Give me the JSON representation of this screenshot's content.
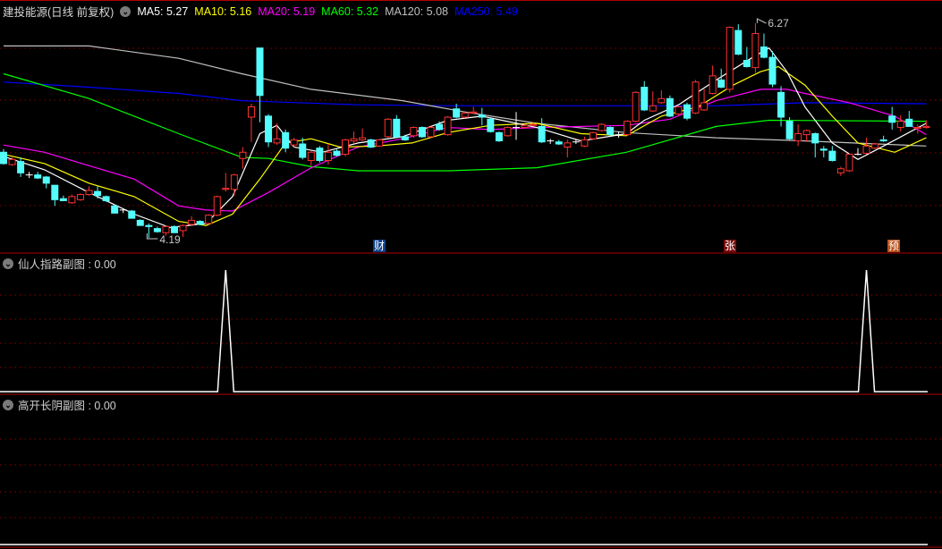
{
  "header": {
    "title": "建投能源(日线 前复权)",
    "ma": [
      {
        "label": "MA5: 5.27",
        "color": "#ffffff"
      },
      {
        "label": "MA10: 5.16",
        "color": "#ffff00"
      },
      {
        "label": "MA20: 5.19",
        "color": "#ff00ff"
      },
      {
        "label": "MA60: 5.32",
        "color": "#00ff00"
      },
      {
        "label": "MA120: 5.08",
        "color": "#c0c0c0"
      },
      {
        "label": "MA250: 5.49",
        "color": "#0000ff"
      }
    ]
  },
  "markers": [
    {
      "text": "财",
      "bg": "#0b3f8a"
    },
    {
      "text": "张",
      "bg": "#7a0c0c"
    },
    {
      "text": "预",
      "bg": "#b8501a"
    }
  ],
  "sub1": {
    "label": "仙人指路副图 : 0.00"
  },
  "sub2": {
    "label": "高开长阴副图 : 0.00"
  },
  "chart_data": {
    "type": "candlestick",
    "title": "建投能源(日线 前复权)",
    "ylim": [
      4.19,
      6.27
    ],
    "high_label": "6.27",
    "low_label": "4.19",
    "colors": {
      "up": "#ff3232",
      "down": "#54fcfc",
      "flat": "#ffffff",
      "grid": "#8b0000"
    },
    "ohlc": [
      [
        5.02,
        5.05,
        4.9,
        4.91
      ],
      [
        4.9,
        4.97,
        4.89,
        4.95
      ],
      [
        4.93,
        4.97,
        4.78,
        4.82
      ],
      [
        4.8,
        4.83,
        4.77,
        4.8
      ],
      [
        4.8,
        4.83,
        4.76,
        4.77
      ],
      [
        4.78,
        4.79,
        4.67,
        4.72
      ],
      [
        4.7,
        4.7,
        4.5,
        4.56
      ],
      [
        4.57,
        4.6,
        4.55,
        4.55
      ],
      [
        4.53,
        4.61,
        4.52,
        4.59
      ],
      [
        4.56,
        4.62,
        4.55,
        4.61
      ],
      [
        4.61,
        4.69,
        4.6,
        4.65
      ],
      [
        4.64,
        4.69,
        4.57,
        4.6
      ],
      [
        4.59,
        4.6,
        4.54,
        4.55
      ],
      [
        4.5,
        4.51,
        4.43,
        4.43
      ],
      [
        4.46,
        4.47,
        4.43,
        4.46
      ],
      [
        4.45,
        4.46,
        4.38,
        4.38
      ],
      [
        4.36,
        4.37,
        4.31,
        4.31
      ],
      [
        4.31,
        4.33,
        4.19,
        4.3
      ],
      [
        4.28,
        4.3,
        4.24,
        4.25
      ],
      [
        4.24,
        4.31,
        4.21,
        4.3
      ],
      [
        4.3,
        4.31,
        4.24,
        4.24
      ],
      [
        4.26,
        4.32,
        4.2,
        4.31
      ],
      [
        4.32,
        4.4,
        4.31,
        4.36
      ],
      [
        4.35,
        4.36,
        4.32,
        4.32
      ],
      [
        4.33,
        4.42,
        4.32,
        4.41
      ],
      [
        4.41,
        4.6,
        4.4,
        4.59
      ],
      [
        4.66,
        4.82,
        4.64,
        4.67
      ],
      [
        4.66,
        4.81,
        4.6,
        4.8
      ],
      [
        4.96,
        5.07,
        4.86,
        5.02
      ],
      [
        5.36,
        5.49,
        5.12,
        5.46
      ],
      [
        6.03,
        6.03,
        5.31,
        5.57
      ],
      [
        5.37,
        5.39,
        5.07,
        5.12
      ],
      [
        5.11,
        5.3,
        5.09,
        5.15
      ],
      [
        5.21,
        5.24,
        5.02,
        5.06
      ],
      [
        5.09,
        5.16,
        5.07,
        5.14
      ],
      [
        5.1,
        5.16,
        4.95,
        4.97
      ],
      [
        4.94,
        5.03,
        4.89,
        5.02
      ],
      [
        5.06,
        5.08,
        4.92,
        4.94
      ],
      [
        4.94,
        5.1,
        4.9,
        5.02
      ],
      [
        5.03,
        5.05,
        4.98,
        4.99
      ],
      [
        5.0,
        5.15,
        4.98,
        5.14
      ],
      [
        5.13,
        5.22,
        5.1,
        5.15
      ],
      [
        5.14,
        5.25,
        5.13,
        5.16
      ],
      [
        5.14,
        5.15,
        5.06,
        5.07
      ],
      [
        5.08,
        5.15,
        5.07,
        5.14
      ],
      [
        5.17,
        5.35,
        5.16,
        5.34
      ],
      [
        5.34,
        5.38,
        5.16,
        5.17
      ],
      [
        5.17,
        5.19,
        5.13,
        5.14
      ],
      [
        5.18,
        5.27,
        5.16,
        5.26
      ],
      [
        5.26,
        5.27,
        5.16,
        5.17
      ],
      [
        5.17,
        5.27,
        5.16,
        5.26
      ],
      [
        5.29,
        5.32,
        5.23,
        5.24
      ],
      [
        5.19,
        5.37,
        5.18,
        5.36
      ],
      [
        5.44,
        5.49,
        5.35,
        5.36
      ],
      [
        5.36,
        5.41,
        5.35,
        5.4
      ],
      [
        5.4,
        5.46,
        5.39,
        5.41
      ],
      [
        5.38,
        5.45,
        5.28,
        5.36
      ],
      [
        5.34,
        5.35,
        5.21,
        5.22
      ],
      [
        5.21,
        5.22,
        5.12,
        5.13
      ],
      [
        5.18,
        5.27,
        5.17,
        5.26
      ],
      [
        5.26,
        5.41,
        5.14,
        5.26
      ],
      [
        5.26,
        5.29,
        5.25,
        5.28
      ],
      [
        5.28,
        5.31,
        5.27,
        5.29
      ],
      [
        5.27,
        5.35,
        5.11,
        5.12
      ],
      [
        5.13,
        5.15,
        5.1,
        5.13
      ],
      [
        5.12,
        5.14,
        5.09,
        5.1
      ],
      [
        5.07,
        5.14,
        4.97,
        5.11
      ],
      [
        5.12,
        5.14,
        5.1,
        5.12
      ],
      [
        5.08,
        5.17,
        5.07,
        5.14
      ],
      [
        5.15,
        5.22,
        5.14,
        5.21
      ],
      [
        5.23,
        5.3,
        5.22,
        5.29
      ],
      [
        5.26,
        5.27,
        5.18,
        5.19
      ],
      [
        5.19,
        5.22,
        5.16,
        5.19
      ],
      [
        5.19,
        5.33,
        5.18,
        5.32
      ],
      [
        5.32,
        5.61,
        5.31,
        5.6
      ],
      [
        5.65,
        5.71,
        5.42,
        5.43
      ],
      [
        5.42,
        5.61,
        5.41,
        5.47
      ],
      [
        5.5,
        5.62,
        5.49,
        5.54
      ],
      [
        5.54,
        5.57,
        5.36,
        5.37
      ],
      [
        5.39,
        5.47,
        5.38,
        5.46
      ],
      [
        5.48,
        5.5,
        5.33,
        5.35
      ],
      [
        5.4,
        5.72,
        5.39,
        5.7
      ],
      [
        5.43,
        5.63,
        5.42,
        5.5
      ],
      [
        5.59,
        5.86,
        5.58,
        5.76
      ],
      [
        5.72,
        5.83,
        5.64,
        5.65
      ],
      [
        5.63,
        6.24,
        5.6,
        6.23
      ],
      [
        6.2,
        6.26,
        5.96,
        5.97
      ],
      [
        5.91,
        6.04,
        5.84,
        5.85
      ],
      [
        5.84,
        6.27,
        5.79,
        6.17
      ],
      [
        6.04,
        6.17,
        5.93,
        5.94
      ],
      [
        5.94,
        6.0,
        5.65,
        5.68
      ],
      [
        5.6,
        5.66,
        5.27,
        5.36
      ],
      [
        5.32,
        5.36,
        5.14,
        5.15
      ],
      [
        5.13,
        5.29,
        5.08,
        5.2
      ],
      [
        5.19,
        5.24,
        5.12,
        5.23
      ],
      [
        5.2,
        5.21,
        4.97,
        5.11
      ],
      [
        5.05,
        5.08,
        4.97,
        5.04
      ],
      [
        5.03,
        5.08,
        4.93,
        4.94
      ],
      [
        4.82,
        4.88,
        4.79,
        4.86
      ],
      [
        4.84,
        5.01,
        4.83,
        5.0
      ],
      [
        5.0,
        5.06,
        4.99,
        5.0
      ],
      [
        5.01,
        5.16,
        5.0,
        5.08
      ],
      [
        5.06,
        5.11,
        5.05,
        5.1
      ],
      [
        5.14,
        5.18,
        5.12,
        5.13
      ],
      [
        5.37,
        5.46,
        5.24,
        5.31
      ],
      [
        5.26,
        5.38,
        5.22,
        5.32
      ],
      [
        5.34,
        5.42,
        5.27,
        5.27
      ],
      [
        5.25,
        5.29,
        5.2,
        5.26
      ],
      [
        5.26,
        5.33,
        5.25,
        5.27
      ]
    ],
    "ma_series": [
      {
        "name": "MA250",
        "color": "#0000ff",
        "points": [
          [
            0,
            5.7
          ],
          [
            10,
            5.65
          ],
          [
            20.5,
            5.59
          ],
          [
            27.9,
            5.52
          ],
          [
            31,
            5.51
          ],
          [
            41.5,
            5.48
          ],
          [
            52,
            5.47
          ],
          [
            83.4,
            5.47
          ],
          [
            93.8,
            5.5
          ],
          [
            108,
            5.49
          ]
        ]
      },
      {
        "name": "MA120",
        "color": "#c0c0c0",
        "points": [
          [
            0,
            6.05
          ],
          [
            10,
            6.05
          ],
          [
            20.5,
            5.93
          ],
          [
            27.9,
            5.78
          ],
          [
            36,
            5.63
          ],
          [
            46.7,
            5.52
          ],
          [
            54,
            5.41
          ],
          [
            62.4,
            5.3
          ],
          [
            72.9,
            5.21
          ],
          [
            83.4,
            5.16
          ],
          [
            93.8,
            5.13
          ],
          [
            108,
            5.08
          ]
        ]
      },
      {
        "name": "MA60",
        "color": "#00ff00",
        "points": [
          [
            0,
            5.78
          ],
          [
            10,
            5.54
          ],
          [
            20.5,
            5.2
          ],
          [
            27.9,
            4.97
          ],
          [
            31,
            4.96
          ],
          [
            36,
            4.88
          ],
          [
            41.5,
            4.84
          ],
          [
            52,
            4.84
          ],
          [
            62.4,
            4.87
          ],
          [
            72.9,
            5.02
          ],
          [
            83.4,
            5.27
          ],
          [
            89.6,
            5.33
          ],
          [
            108,
            5.32
          ]
        ]
      },
      {
        "name": "MA20",
        "color": "#ff00ff",
        "points": [
          [
            0,
            5.09
          ],
          [
            4.8,
            5.02
          ],
          [
            10,
            4.89
          ],
          [
            15.3,
            4.76
          ],
          [
            20.5,
            4.5
          ],
          [
            23.7,
            4.46
          ],
          [
            26.8,
            4.45
          ],
          [
            31,
            4.63
          ],
          [
            36,
            4.87
          ],
          [
            41.5,
            5.07
          ],
          [
            46.7,
            5.15
          ],
          [
            52,
            5.26
          ],
          [
            57,
            5.24
          ],
          [
            62.4,
            5.26
          ],
          [
            72.9,
            5.28
          ],
          [
            78,
            5.34
          ],
          [
            83.4,
            5.52
          ],
          [
            88.6,
            5.63
          ],
          [
            91.7,
            5.63
          ],
          [
            93.8,
            5.59
          ],
          [
            99,
            5.5
          ],
          [
            104.3,
            5.37
          ],
          [
            108,
            5.19
          ]
        ]
      },
      {
        "name": "MA10",
        "color": "#ffff00",
        "points": [
          [
            0,
            5.0
          ],
          [
            4.8,
            4.91
          ],
          [
            10,
            4.72
          ],
          [
            15.3,
            4.59
          ],
          [
            20.5,
            4.35
          ],
          [
            23.7,
            4.31
          ],
          [
            26.8,
            4.42
          ],
          [
            30,
            4.76
          ],
          [
            33,
            5.11
          ],
          [
            36,
            5.15
          ],
          [
            39.4,
            5.07
          ],
          [
            43.6,
            5.08
          ],
          [
            47.8,
            5.11
          ],
          [
            52,
            5.21
          ],
          [
            57,
            5.28
          ],
          [
            62.4,
            5.3
          ],
          [
            67.6,
            5.2
          ],
          [
            72.9,
            5.18
          ],
          [
            77,
            5.37
          ],
          [
            81.3,
            5.46
          ],
          [
            85.4,
            5.67
          ],
          [
            88.6,
            5.8
          ],
          [
            90.7,
            5.85
          ],
          [
            93.8,
            5.67
          ],
          [
            97,
            5.37
          ],
          [
            100,
            5.11
          ],
          [
            104.3,
            5.02
          ],
          [
            108,
            5.16
          ]
        ]
      },
      {
        "name": "MA5",
        "color": "#ffffff",
        "points": [
          [
            0,
            4.98
          ],
          [
            4.8,
            4.85
          ],
          [
            10,
            4.63
          ],
          [
            15.3,
            4.42
          ],
          [
            19.5,
            4.29
          ],
          [
            23.7,
            4.33
          ],
          [
            26.8,
            4.59
          ],
          [
            30,
            5.2
          ],
          [
            32,
            5.28
          ],
          [
            34,
            5.07
          ],
          [
            37.3,
            5.02
          ],
          [
            41.5,
            5.11
          ],
          [
            46.7,
            5.17
          ],
          [
            52,
            5.33
          ],
          [
            56,
            5.37
          ],
          [
            62.4,
            5.26
          ],
          [
            67.6,
            5.13
          ],
          [
            72.9,
            5.2
          ],
          [
            75,
            5.33
          ],
          [
            79,
            5.48
          ],
          [
            83.4,
            5.72
          ],
          [
            87.5,
            5.93
          ],
          [
            89.6,
            6.03
          ],
          [
            91.7,
            5.8
          ],
          [
            93.8,
            5.46
          ],
          [
            97,
            5.11
          ],
          [
            100,
            4.95
          ],
          [
            103,
            5.08
          ],
          [
            108,
            5.3
          ]
        ]
      }
    ],
    "signal_spikes": {
      "sub1_indices": [
        26,
        101
      ],
      "sub1_value": 0.0,
      "sub2_value": 0.0
    }
  }
}
